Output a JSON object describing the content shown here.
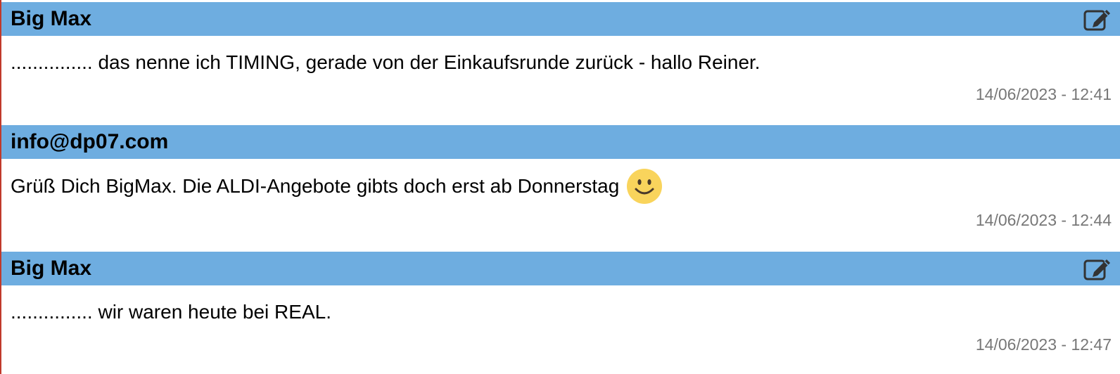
{
  "posts": [
    {
      "author": "Big Max",
      "message": "............... das nenne ich TIMING, gerade von der Einkaufsrunde zurück - hallo Reiner.",
      "timestamp": "14/06/2023 - 12:41",
      "editable": true
    },
    {
      "author": "info@dp07.com",
      "message": "Grüß Dich BigMax. Die ALDI-Angebote gibts doch erst ab Donnerstag",
      "emoji": "smiley-face-icon",
      "timestamp": "14/06/2023 - 12:44",
      "editable": false
    },
    {
      "author": "Big Max",
      "message": "............... wir waren heute bei REAL.",
      "timestamp": "14/06/2023 - 12:47",
      "editable": true
    }
  ],
  "colors": {
    "header_bg": "#6eade0",
    "timestamp_text": "#777777",
    "left_border": "#c0392b",
    "smiley_fill": "#f9d45c"
  },
  "icons": {
    "edit": "edit-pencil-square-icon",
    "emoji": "smiley-face-icon"
  }
}
